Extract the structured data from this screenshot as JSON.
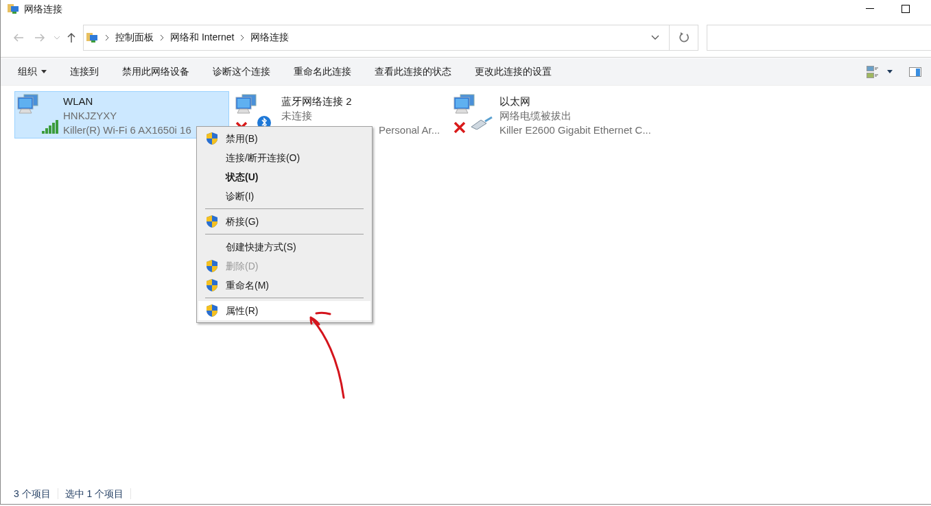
{
  "window": {
    "title": "网络连接"
  },
  "address": {
    "crumbs": [
      "控制面板",
      "网络和 Internet",
      "网络连接"
    ]
  },
  "toolbar": {
    "items": [
      {
        "label": "组织",
        "dropdown": true
      },
      {
        "label": "连接到",
        "dropdown": false
      },
      {
        "label": "禁用此网络设备",
        "dropdown": false
      },
      {
        "label": "诊断这个连接",
        "dropdown": false
      },
      {
        "label": "重命名此连接",
        "dropdown": false
      },
      {
        "label": "查看此连接的状态",
        "dropdown": false
      },
      {
        "label": "更改此连接的设置",
        "dropdown": false
      }
    ]
  },
  "connections": [
    {
      "name": "WLAN",
      "status": "HNKJZYXY",
      "device": "Killer(R) Wi-Fi 6 AX1650i 16",
      "kind": "wifi",
      "disconnected": false,
      "selected": true
    },
    {
      "name": "蓝牙网络连接 2",
      "status": "未连接",
      "device": "Personal Ar...",
      "kind": "bluetooth",
      "disconnected": true,
      "selected": false
    },
    {
      "name": "以太网",
      "status": "网络电缆被拔出",
      "device": "Killer E2600 Gigabit Ethernet C...",
      "kind": "ethernet",
      "disconnected": true,
      "selected": false
    }
  ],
  "context_menu": {
    "items": [
      {
        "kind": "item",
        "label": "禁用(B)",
        "shield": true,
        "default": false,
        "disabled": false,
        "selected": false
      },
      {
        "kind": "item",
        "label": "连接/断开连接(O)",
        "shield": false,
        "default": false,
        "disabled": false,
        "selected": false
      },
      {
        "kind": "item",
        "label": "状态(U)",
        "shield": false,
        "default": true,
        "disabled": false,
        "selected": false
      },
      {
        "kind": "item",
        "label": "诊断(I)",
        "shield": false,
        "default": false,
        "disabled": false,
        "selected": false
      },
      {
        "kind": "separator"
      },
      {
        "kind": "item",
        "label": "桥接(G)",
        "shield": true,
        "default": false,
        "disabled": false,
        "selected": false
      },
      {
        "kind": "separator"
      },
      {
        "kind": "item",
        "label": "创建快捷方式(S)",
        "shield": false,
        "default": false,
        "disabled": false,
        "selected": false
      },
      {
        "kind": "item",
        "label": "删除(D)",
        "shield": true,
        "default": false,
        "disabled": true,
        "selected": false
      },
      {
        "kind": "item",
        "label": "重命名(M)",
        "shield": true,
        "default": false,
        "disabled": false,
        "selected": false
      },
      {
        "kind": "separator"
      },
      {
        "kind": "item",
        "label": "属性(R)",
        "shield": true,
        "default": false,
        "disabled": false,
        "selected": true
      }
    ]
  },
  "status_bar": {
    "item_count": "3 个项目",
    "selection": "选中 1 个项目"
  }
}
